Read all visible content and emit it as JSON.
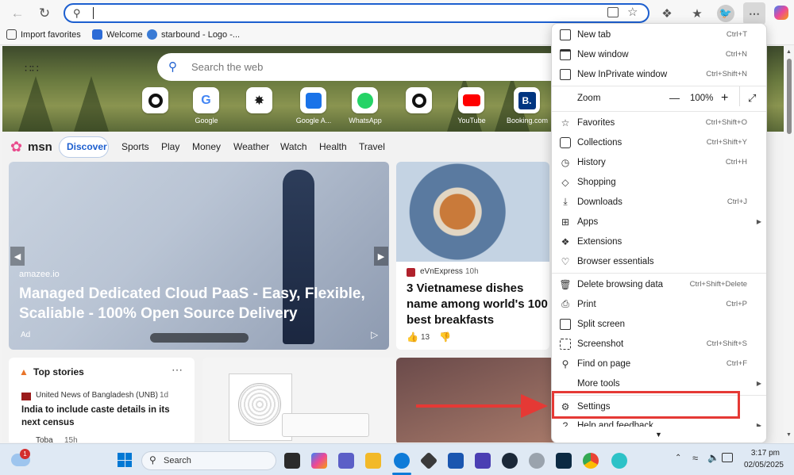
{
  "toolbar": {
    "address_value": "",
    "profile_icon": "bird-avatar-icon"
  },
  "favorites_bar": {
    "items": [
      "Import favorites",
      "Welcome",
      "starbound - Logo -..."
    ]
  },
  "msn": {
    "search_placeholder": "Search the web",
    "quick_links": [
      "",
      "Google",
      "",
      "Google A...",
      "WhatsApp",
      "",
      "YouTube",
      "Booking.com"
    ],
    "brand": "msn",
    "nav": [
      "Discover",
      "Sports",
      "Play",
      "Money",
      "Weather",
      "Watch",
      "Health",
      "Travel"
    ],
    "hero_card": {
      "source": "amazee.io",
      "title": "Managed Dedicated Cloud PaaS - Easy, Flexible, Scaliable - 100% Open Source Delivery",
      "badge": "Ad"
    },
    "news_card": {
      "source": "eVnExpress",
      "age": "10h",
      "title": "3 Vietnamese dishes name among world's 100 best breakfasts",
      "likes": "13"
    },
    "top_stories": {
      "label": "Top stories",
      "item_source": "United News of Bangladesh (UNB)",
      "item_age": "1d",
      "item_title": "India to include caste details in its next census",
      "next_source": "Toba",
      "next_age": "15h"
    }
  },
  "menu": {
    "items": [
      {
        "icon": "new-tab-icon",
        "label": "New tab",
        "shortcut": "Ctrl+T"
      },
      {
        "icon": "new-window-icon",
        "label": "New window",
        "shortcut": "Ctrl+N"
      },
      {
        "icon": "inprivate-icon",
        "label": "New InPrivate window",
        "shortcut": "Ctrl+Shift+N"
      },
      {
        "icon": "star-icon",
        "label": "Favorites",
        "shortcut": "Ctrl+Shift+O"
      },
      {
        "icon": "collections-icon",
        "label": "Collections",
        "shortcut": "Ctrl+Shift+Y"
      },
      {
        "icon": "history-icon",
        "label": "History",
        "shortcut": "Ctrl+H"
      },
      {
        "icon": "shopping-icon",
        "label": "Shopping",
        "shortcut": ""
      },
      {
        "icon": "download-icon",
        "label": "Downloads",
        "shortcut": "Ctrl+J"
      },
      {
        "icon": "apps-icon",
        "label": "Apps",
        "shortcut": ""
      },
      {
        "icon": "extensions-icon",
        "label": "Extensions",
        "shortcut": ""
      },
      {
        "icon": "heart-icon",
        "label": "Browser essentials",
        "shortcut": ""
      },
      {
        "icon": "trash-icon",
        "label": "Delete browsing data",
        "shortcut": "Ctrl+Shift+Delete"
      },
      {
        "icon": "print-icon",
        "label": "Print",
        "shortcut": "Ctrl+P"
      },
      {
        "icon": "split-screen-icon",
        "label": "Split screen",
        "shortcut": ""
      },
      {
        "icon": "screenshot-icon",
        "label": "Screenshot",
        "shortcut": "Ctrl+Shift+S"
      },
      {
        "icon": "find-icon",
        "label": "Find on page",
        "shortcut": "Ctrl+F"
      },
      {
        "icon": "",
        "label": "More tools",
        "shortcut": ""
      },
      {
        "icon": "gear-icon",
        "label": "Settings",
        "shortcut": ""
      },
      {
        "icon": "help-icon",
        "label": "Help and feedback",
        "shortcut": ""
      }
    ],
    "zoom_label": "Zoom",
    "zoom_value": "100%",
    "zoom_out": "—",
    "zoom_in": "+"
  },
  "taskbar": {
    "search_placeholder": "Search",
    "weather_badge": "1",
    "time": "3:17 pm",
    "date": "02/05/2025"
  },
  "colors": {
    "accent": "#1d5fcf",
    "highlight": "#e53935"
  }
}
